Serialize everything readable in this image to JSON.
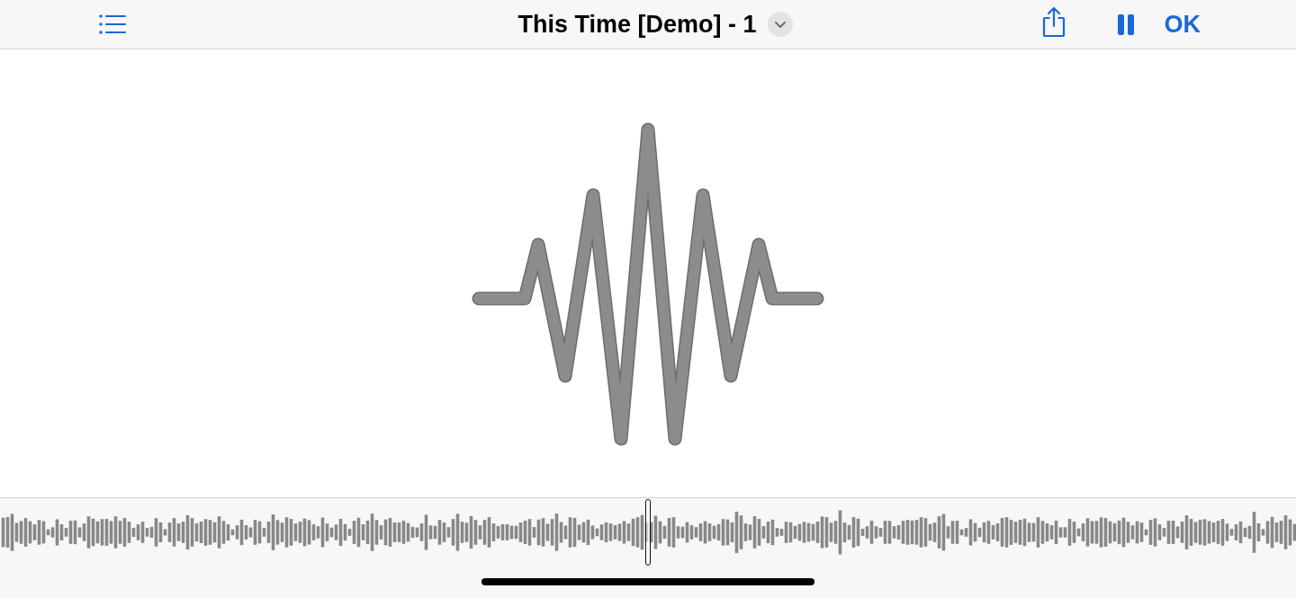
{
  "toolbar": {
    "title": "This Time [Demo] - 1",
    "playing": true,
    "confirm_label": "OK"
  }
}
